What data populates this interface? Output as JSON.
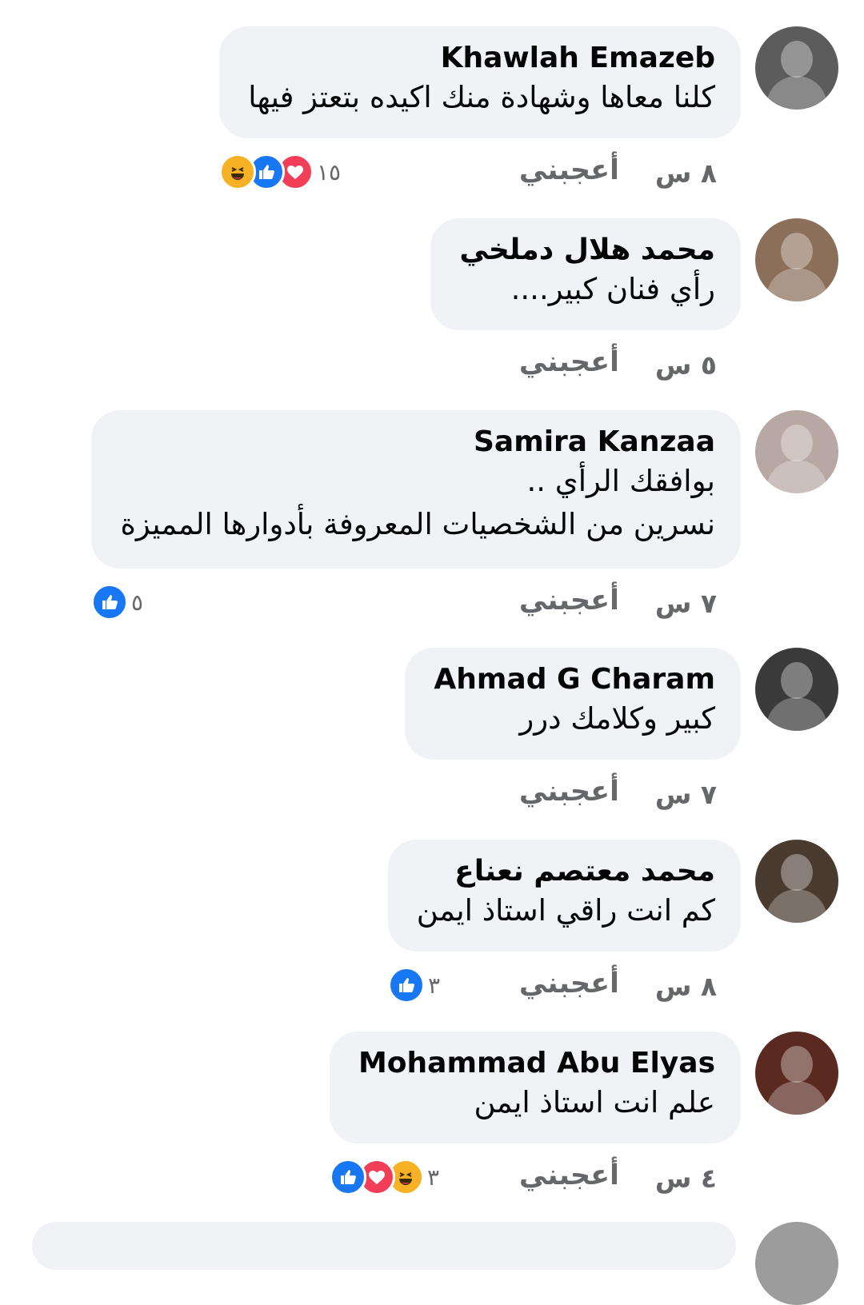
{
  "like_label": "أعجبني",
  "colors": {
    "bubble": "#f0f2f5",
    "meta": "#65676b",
    "like_blue": "#1877f2",
    "love_red": "#f33e58",
    "haha_yellow": "#f7b125"
  },
  "comments": [
    {
      "author": "Khawlah Emazeb",
      "lines": [
        "كلنا معاها وشهادة منك اكيده بتعتز فيها"
      ],
      "time": "٨ س",
      "reaction_count": "١٥",
      "reactions": [
        "love",
        "like",
        "haha"
      ],
      "avatar": "avatar-icon"
    },
    {
      "author": "محمد هلال دملخي",
      "lines": [
        "رأي فنان كبير...."
      ],
      "time": "٥ س",
      "reaction_count": "",
      "reactions": [],
      "avatar": "avatar-icon"
    },
    {
      "author": "Samira Kanzaa",
      "lines": [
        "بوافقك الرأي ..",
        "نسرين من الشخصيات المعروفة بأدوارها المميزة"
      ],
      "time": "٧ س",
      "reaction_count": "٥",
      "reactions": [
        "like"
      ],
      "avatar": "avatar-icon"
    },
    {
      "author": "Ahmad G Charam",
      "lines": [
        "كبير وكلامك درر"
      ],
      "time": "٧ س",
      "reaction_count": "",
      "reactions": [],
      "avatar": "avatar-icon"
    },
    {
      "author": "محمد معتصم نعناع",
      "lines": [
        "كم انت راقي استاذ ايمن"
      ],
      "time": "٨ س",
      "reaction_count": "٣",
      "reactions": [
        "like"
      ],
      "avatar": "avatar-icon"
    },
    {
      "author": "Mohammad Abu Elyas",
      "lines": [
        "علم انت استاذ ايمن"
      ],
      "time": "٤ س",
      "reaction_count": "٣",
      "reactions": [
        "haha",
        "love",
        "like"
      ],
      "avatar": "avatar-icon"
    }
  ]
}
